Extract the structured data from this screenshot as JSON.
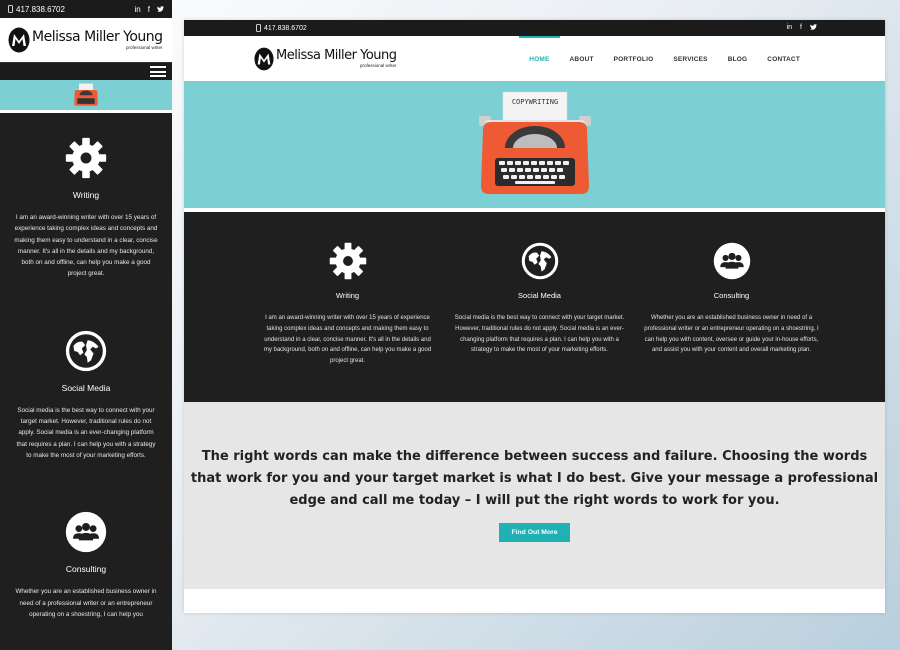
{
  "brand": {
    "phone": "417.838.6702",
    "name": "Melissa Miller Young",
    "tagline": "professional writer",
    "accent": "#1fb1b4",
    "hero_bg": "#7ccfd3"
  },
  "social": [
    {
      "icon": "linkedin-icon",
      "glyph": "in"
    },
    {
      "icon": "facebook-icon",
      "glyph": "f"
    },
    {
      "icon": "twitter-icon",
      "glyph": "🐦"
    }
  ],
  "nav": [
    {
      "label": "HOME",
      "active": true
    },
    {
      "label": "ABOUT"
    },
    {
      "label": "PORTFOLIO"
    },
    {
      "label": "SERVICES"
    },
    {
      "label": "BLOG"
    },
    {
      "label": "CONTACT"
    }
  ],
  "hero": {
    "paper_text": "COPYWRITING"
  },
  "services": [
    {
      "title": "Writing",
      "icon": "gear-icon",
      "text": "I am an award-winning writer with over 15 years of experience taking complex ideas and concepts and making them easy to understand in a clear, concise manner. It's all in the details and my background, both on and offline, can help you make a good project great."
    },
    {
      "title": "Social Media",
      "icon": "globe-icon",
      "text": "Social media is the best way to connect with your target market. However, traditional rules do not apply. Social media is an ever-changing platform that requires a plan. I can help you with a strategy to make the most of your marketing efforts."
    },
    {
      "title": "Consulting",
      "icon": "people-icon",
      "text": "Whether you are an established business owner in need of a professional writer or an entrepreneur operating on a shoestring, I can help you with content, oversee or guide your in-house efforts, and assist you with your content and overall marketing plan."
    }
  ],
  "mobile_consulting_excerpt": "Whether you are an established business owner in need of a professional writer or an entrepreneur operating on a shoestring, I can help you",
  "tagline": {
    "text": "The right words can make the difference between success and failure. Choosing the words that work for you and your target market is what I do best. Give your message a professional edge and call me today – I will put the right words to work for you.",
    "button": "Find Out More"
  }
}
